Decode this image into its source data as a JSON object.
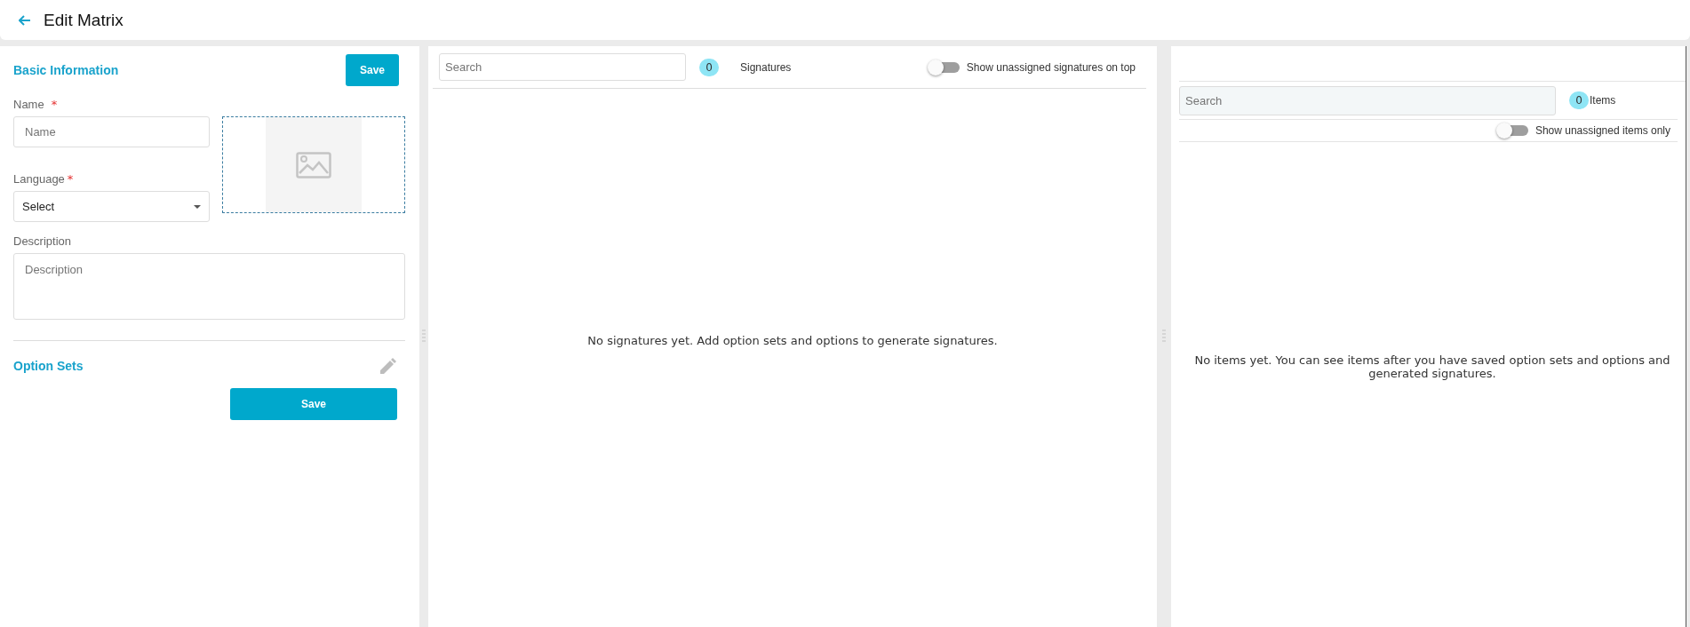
{
  "header": {
    "title": "Edit Matrix"
  },
  "basic_information": {
    "heading": "Basic Information",
    "save_button": "Save",
    "name": {
      "label": "Name",
      "required_mark": "*",
      "placeholder": "Name"
    },
    "language": {
      "label": "Language",
      "required_mark": "*",
      "value": "Select"
    },
    "description": {
      "label": "Description",
      "placeholder": "Description"
    }
  },
  "option_sets": {
    "heading": "Option Sets",
    "save_button": "Save"
  },
  "signatures": {
    "search": {
      "placeholder": "Search"
    },
    "count": "0",
    "count_label": "Signatures",
    "toggle": {
      "label": "Show unassigned signatures on top",
      "on": false
    },
    "empty_message": "No signatures yet. Add option sets and options to generate signatures."
  },
  "items": {
    "search": {
      "placeholder": "Search"
    },
    "count": "0",
    "count_label": "Items",
    "toggle": {
      "label": "Show unassigned items only",
      "on": false
    },
    "empty_message": "No items yet. You can see items after you have saved option sets and options and generated signatures."
  }
}
